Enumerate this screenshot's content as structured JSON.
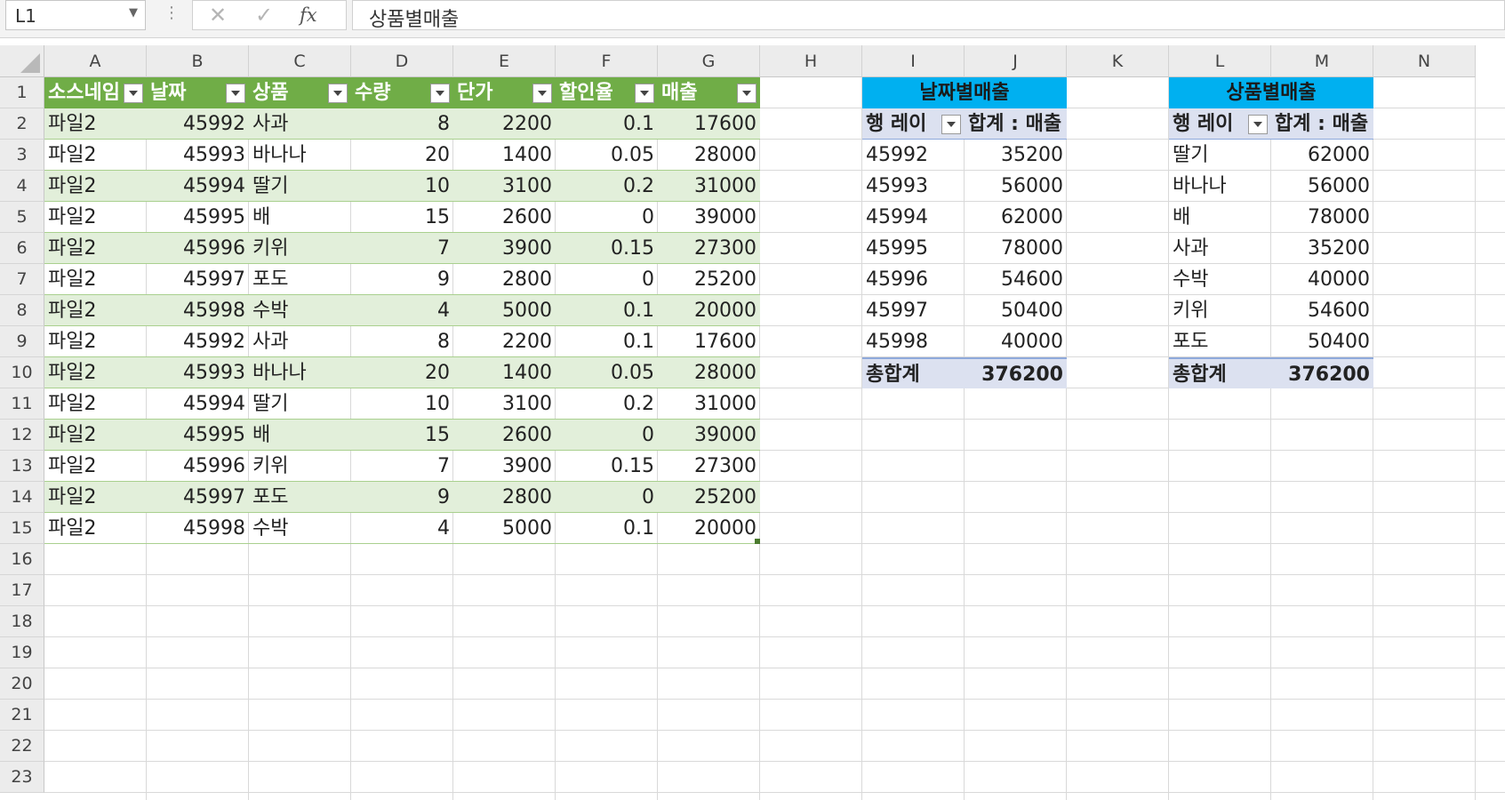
{
  "formula_bar": {
    "name_box": "L1",
    "cancel_icon": "✕",
    "enter_icon": "✓",
    "fx_label": "fx",
    "content": "상품별매출"
  },
  "columns": [
    "A",
    "B",
    "C",
    "D",
    "E",
    "F",
    "G",
    "H",
    "I",
    "J",
    "K",
    "L",
    "M",
    "N"
  ],
  "rows": [
    "1",
    "2",
    "3",
    "4",
    "5",
    "6",
    "7",
    "8",
    "9",
    "10",
    "11",
    "12",
    "13",
    "14",
    "15",
    "16",
    "17",
    "18",
    "19",
    "20",
    "21",
    "22",
    "23"
  ],
  "table": {
    "headers": [
      "소스네임",
      "날짜",
      "상품",
      "수량",
      "단가",
      "할인율",
      "매출"
    ],
    "data": [
      [
        "파일2",
        "45992",
        "사과",
        "8",
        "2200",
        "0.1",
        "17600"
      ],
      [
        "파일2",
        "45993",
        "바나나",
        "20",
        "1400",
        "0.05",
        "28000"
      ],
      [
        "파일2",
        "45994",
        "딸기",
        "10",
        "3100",
        "0.2",
        "31000"
      ],
      [
        "파일2",
        "45995",
        "배",
        "15",
        "2600",
        "0",
        "39000"
      ],
      [
        "파일2",
        "45996",
        "키위",
        "7",
        "3900",
        "0.15",
        "27300"
      ],
      [
        "파일2",
        "45997",
        "포도",
        "9",
        "2800",
        "0",
        "25200"
      ],
      [
        "파일2",
        "45998",
        "수박",
        "4",
        "5000",
        "0.1",
        "20000"
      ],
      [
        "파일2",
        "45992",
        "사과",
        "8",
        "2200",
        "0.1",
        "17600"
      ],
      [
        "파일2",
        "45993",
        "바나나",
        "20",
        "1400",
        "0.05",
        "28000"
      ],
      [
        "파일2",
        "45994",
        "딸기",
        "10",
        "3100",
        "0.2",
        "31000"
      ],
      [
        "파일2",
        "45995",
        "배",
        "15",
        "2600",
        "0",
        "39000"
      ],
      [
        "파일2",
        "45996",
        "키위",
        "7",
        "3900",
        "0.15",
        "27300"
      ],
      [
        "파일2",
        "45997",
        "포도",
        "9",
        "2800",
        "0",
        "25200"
      ],
      [
        "파일2",
        "45998",
        "수박",
        "4",
        "5000",
        "0.1",
        "20000"
      ]
    ]
  },
  "pivot_date": {
    "title": "날짜별매출",
    "row_label": "행 레이",
    "sum_label": "합계 : 매출",
    "rows": [
      [
        "45992",
        "35200"
      ],
      [
        "45993",
        "56000"
      ],
      [
        "45994",
        "62000"
      ],
      [
        "45995",
        "78000"
      ],
      [
        "45996",
        "54600"
      ],
      [
        "45997",
        "50400"
      ],
      [
        "45998",
        "40000"
      ]
    ],
    "total_label": "총합계",
    "total_value": "376200"
  },
  "pivot_product": {
    "title": "상품별매출",
    "row_label": "행 레이",
    "sum_label": "합계 : 매출",
    "rows": [
      [
        "딸기",
        "62000"
      ],
      [
        "바나나",
        "56000"
      ],
      [
        "배",
        "78000"
      ],
      [
        "사과",
        "35200"
      ],
      [
        "수박",
        "40000"
      ],
      [
        "키위",
        "54600"
      ],
      [
        "포도",
        "50400"
      ]
    ],
    "total_label": "총합계",
    "total_value": "376200"
  },
  "colors": {
    "table_header": "#70ad47",
    "table_band": "#e2efda",
    "pivot_title": "#00b0f0",
    "pivot_header": "#dce1f0"
  }
}
